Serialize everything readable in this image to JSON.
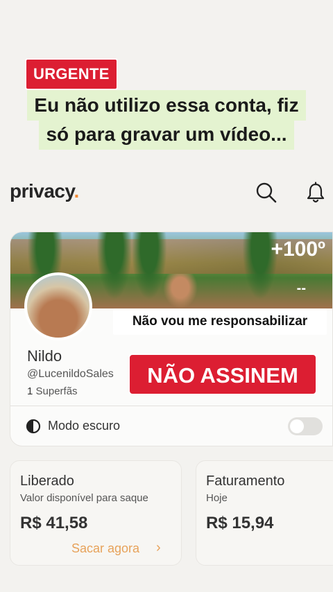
{
  "overlay": {
    "badge": "URGENTE",
    "headline_line1": "Eu não utilizo essa conta, fiz",
    "headline_line2": "só para gravar um vídeo...",
    "disclaimer": "Não vou me responsabilizar",
    "warning": "NÃO ASSINEM"
  },
  "header": {
    "logo_text": "privacy",
    "logo_dot": ".",
    "accent": "#f28c38",
    "icons": [
      "search-icon",
      "bell-icon"
    ]
  },
  "profile": {
    "cover_badge": "+100º",
    "cover_dashes": "--",
    "name": "Nildo",
    "handle": "@LucenildoSales",
    "fans_count": "1",
    "fans_label": "Superfãs"
  },
  "settings": {
    "dark_mode_label": "Modo escuro",
    "dark_mode_on": false
  },
  "stats": {
    "released": {
      "title": "Liberado",
      "subtitle": "Valor disponível para saque",
      "value": "R$ 41,58",
      "action": "Sacar agora",
      "action_chevron": "›"
    },
    "revenue": {
      "title": "Faturamento",
      "subtitle": "Hoje",
      "value": "R$ 15,94"
    }
  },
  "colors": {
    "red": "#dc1e32",
    "highlight": "#e4f3d0",
    "withdraw": "#e7a25a"
  }
}
